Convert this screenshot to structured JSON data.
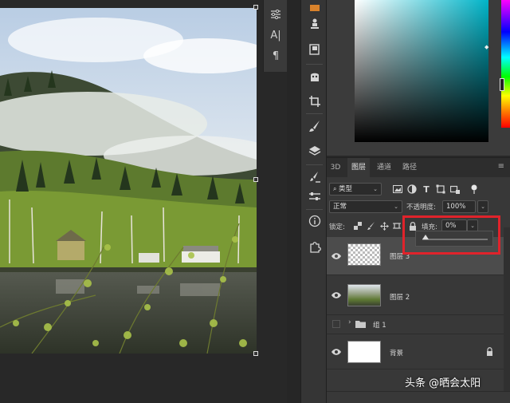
{
  "canvas": {
    "image": "forest-lake-photo"
  },
  "mini_panel": {
    "icons": [
      "adjustments-icon",
      "character-icon",
      "paragraph-icon"
    ],
    "char_label": "A|",
    "para_label": "¶"
  },
  "tool_strip": {
    "icons": [
      "clone-source-icon",
      "layer-comps-icon",
      "history-icon",
      "crop-icon",
      "brush-icon",
      "layers-icon",
      "brush-settings-icon",
      "properties-icon",
      "info-icon",
      "plugin-icon"
    ]
  },
  "layers_panel": {
    "tabs": [
      "3D",
      "图层",
      "通道",
      "路径"
    ],
    "active_tab": "图层",
    "filter_kind": "类型",
    "blend_mode": "正常",
    "opacity_label": "不透明度:",
    "opacity_value": "100%",
    "lock_label": "锁定:",
    "fill_label": "填充:",
    "fill_value": "0%",
    "fill_slider_fraction": 0.0,
    "layers": [
      {
        "name": "图层 3",
        "type": "transparent",
        "visible": true,
        "selected": true
      },
      {
        "name": "图层 2",
        "type": "photo",
        "visible": true,
        "selected": false
      },
      {
        "name": "组 1",
        "type": "group",
        "visible": false,
        "selected": false
      },
      {
        "name": "背景",
        "type": "background",
        "visible": true,
        "selected": false,
        "locked": true
      }
    ]
  },
  "watermark": {
    "text": "头条 @晒会太阳"
  },
  "colors": {
    "highlight": "#e0232b",
    "panel_bg": "#383838"
  }
}
